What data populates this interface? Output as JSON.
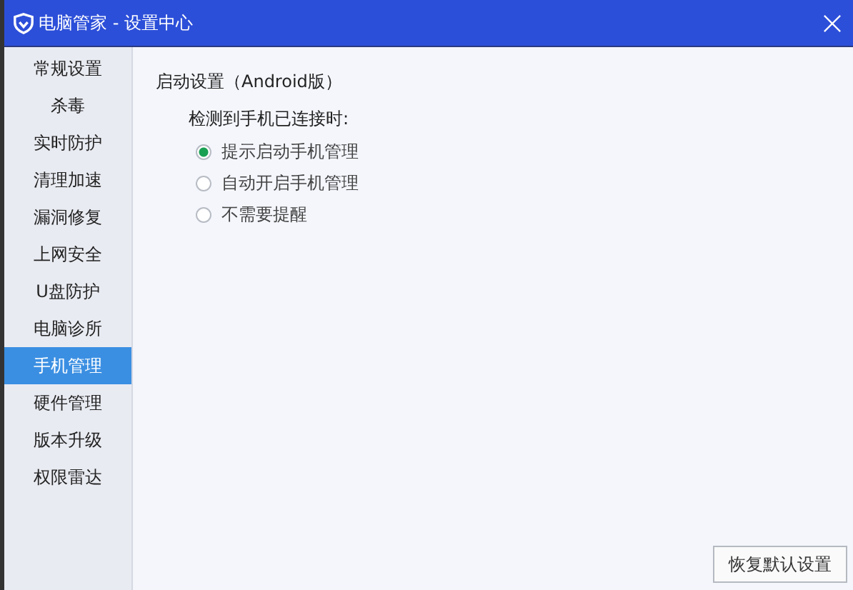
{
  "window": {
    "title": "电脑管家 - 设置中心"
  },
  "sidebar": {
    "items": [
      {
        "label": "常规设置",
        "selected": false
      },
      {
        "label": "杀毒",
        "selected": false
      },
      {
        "label": "实时防护",
        "selected": false
      },
      {
        "label": "清理加速",
        "selected": false
      },
      {
        "label": "漏洞修复",
        "selected": false
      },
      {
        "label": "上网安全",
        "selected": false
      },
      {
        "label": "U盘防护",
        "selected": false
      },
      {
        "label": "电脑诊所",
        "selected": false
      },
      {
        "label": "手机管理",
        "selected": true
      },
      {
        "label": "硬件管理",
        "selected": false
      },
      {
        "label": "版本升级",
        "selected": false
      },
      {
        "label": "权限雷达",
        "selected": false
      }
    ]
  },
  "section": {
    "title": "启动设置（Android版）",
    "prompt": "检测到手机已连接时:",
    "options": [
      {
        "label": "提示启动手机管理",
        "selected": true
      },
      {
        "label": "自动开启手机管理",
        "selected": false
      },
      {
        "label": "不需要提醒",
        "selected": false
      }
    ]
  },
  "buttons": [
    "恢复默认设置"
  ]
}
